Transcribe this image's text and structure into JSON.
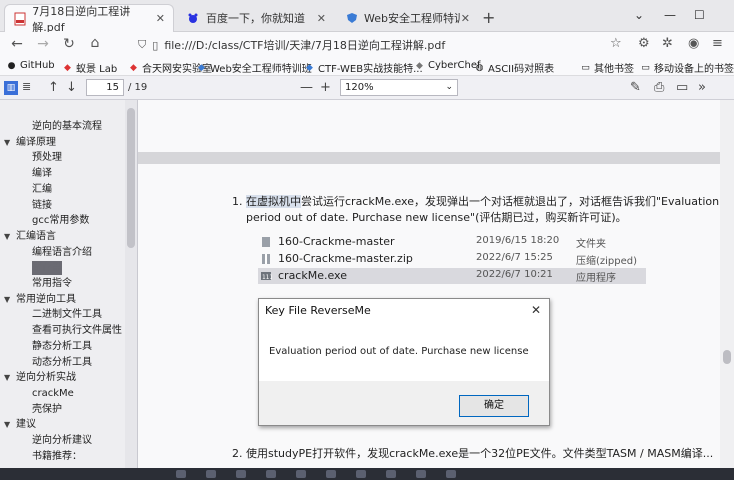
{
  "browser": {
    "tabs": [
      {
        "label": "7月18日逆向工程讲解.pdf",
        "active": true,
        "icon": "pdf-icon"
      },
      {
        "label": "百度一下，你就知道",
        "active": false,
        "icon": "baidu-paw-icon"
      },
      {
        "label": "Web安全工程师特训班（安全...",
        "active": false,
        "icon": "shield-icon"
      }
    ],
    "new_tab": "+",
    "url": "file:///D:/class/CTF培训/天津/7月18日逆向工程讲解.pdf"
  },
  "bookmarks": [
    {
      "label": "GitHub",
      "icon": "github-icon"
    },
    {
      "label": "蚁景 Lab",
      "icon": "lab-icon"
    },
    {
      "label": "合天网安实验室",
      "icon": "lab-icon"
    },
    {
      "label": "Web安全工程师特训班",
      "icon": "shield-icon"
    },
    {
      "label": "CTF-WEB实战技能特...",
      "icon": "flag-icon"
    },
    {
      "label": "CyberChef",
      "icon": "chef-icon"
    },
    {
      "label": "ASCII码对照表",
      "icon": "globe-icon"
    },
    {
      "label": "其他书签",
      "icon": "folder-icon"
    },
    {
      "label": "移动设备上的书签",
      "icon": "folder-icon"
    }
  ],
  "pdf_toolbar": {
    "page_current": "15",
    "page_total": "/ 19",
    "zoom": "120%",
    "zoom_minus": "—",
    "zoom_plus": "+"
  },
  "outline": [
    {
      "label": "逆向的基本流程",
      "level": 2,
      "selected": false
    },
    {
      "label": "编译原理",
      "level": 1,
      "twisty": "▼",
      "selected": false
    },
    {
      "label": "预处理",
      "level": 2,
      "selected": false
    },
    {
      "label": "编译",
      "level": 2,
      "selected": false
    },
    {
      "label": "汇编",
      "level": 2,
      "selected": false
    },
    {
      "label": "链接",
      "level": 2,
      "selected": false
    },
    {
      "label": "gcc常用参数",
      "level": 2,
      "selected": false
    },
    {
      "label": "汇编语言",
      "level": 1,
      "twisty": "▼",
      "selected": false
    },
    {
      "label": "编程语言介绍",
      "level": 2,
      "selected": false
    },
    {
      "label": "寄存器",
      "level": 2,
      "selected": true
    },
    {
      "label": "常用指令",
      "level": 2,
      "selected": false
    },
    {
      "label": "常用逆向工具",
      "level": 1,
      "twisty": "▼",
      "selected": false
    },
    {
      "label": "二进制文件工具",
      "level": 2,
      "selected": false
    },
    {
      "label": "查看可执行文件属性",
      "level": 2,
      "selected": false
    },
    {
      "label": "静态分析工具",
      "level": 2,
      "selected": false
    },
    {
      "label": "动态分析工具",
      "level": 2,
      "selected": false
    },
    {
      "label": "逆向分析实战",
      "level": 1,
      "twisty": "▼",
      "selected": false
    },
    {
      "label": "crackMe",
      "level": 2,
      "selected": false
    },
    {
      "label": "壳保护",
      "level": 2,
      "selected": false
    },
    {
      "label": "建议",
      "level": 1,
      "twisty": "▼",
      "selected": false
    },
    {
      "label": "逆向分析建议",
      "level": 2,
      "selected": false
    },
    {
      "label": "书籍推荐：",
      "level": 2,
      "selected": false
    }
  ],
  "document": {
    "item1_number": "1.",
    "item1_line1_highlight": "在虚拟机中",
    "item1_line1_rest": "尝试运行crackMe.exe，发现弹出一个对话框就退出了，对话框告诉我们\"Evaluation",
    "item1_line2": "period out of date. Purchase new license\"(评估期已过，购买新许可证)。",
    "files": [
      {
        "name": "160-Crackme-master",
        "date": "2019/6/15 18:20",
        "type": "文件夹",
        "icon": "folder-icon",
        "selected": false
      },
      {
        "name": "160-Crackme-master.zip",
        "date": "2022/6/7 15:25",
        "type": "压缩(zipped)文",
        "icon": "zip-icon",
        "selected": false
      },
      {
        "name": "crackMe.exe",
        "date": "2022/6/7 10:21",
        "type": "应用程序",
        "icon": "exe-icon",
        "selected": true
      }
    ],
    "item2_number": "2.",
    "item2_text": "使用studyPE打开软件，发现crackMe.exe是一个32位PE文件。文件类型TASM / MASM编译..."
  },
  "dialog": {
    "title": "Key File ReverseMe",
    "message": "Evaluation period out of date. Purchase new license",
    "ok_label": "确定",
    "close_label": "✕"
  },
  "colors": {
    "accent": "#0067c0",
    "sidebar_bg": "#eeeef1",
    "selected_item": "#6b6b73"
  }
}
